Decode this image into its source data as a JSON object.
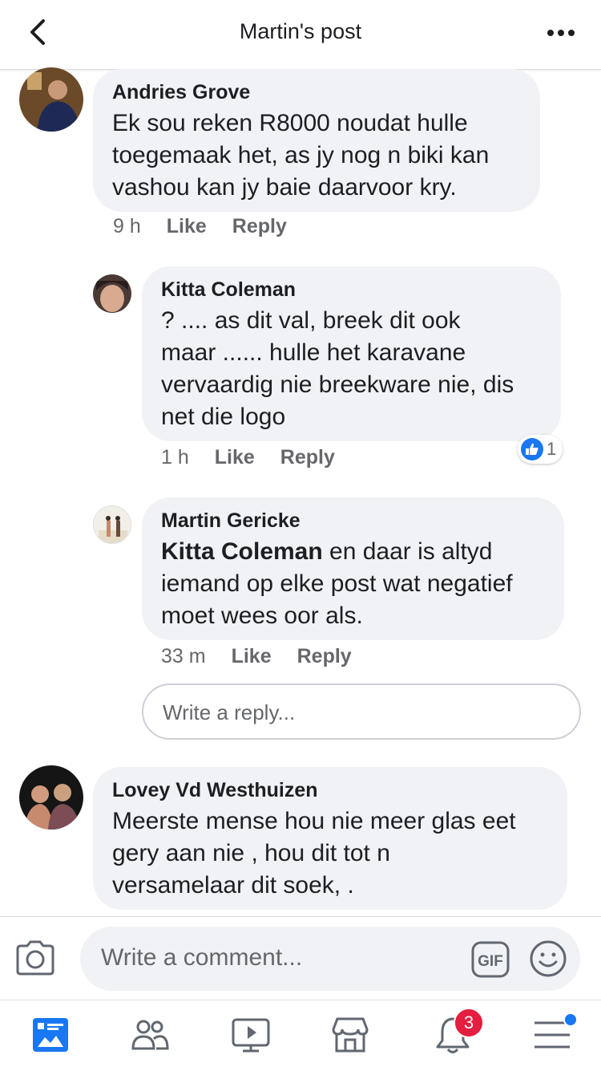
{
  "header": {
    "title": "Martin's post"
  },
  "comments": [
    {
      "author": "Andries Grove",
      "text_lines": [
        "Ek sou reken R8000 noudat hulle",
        "toegemaak het, as jy nog n biki kan",
        "vashou kan jy baie daarvoor kry."
      ],
      "time": "9 h",
      "like": "Like",
      "reply": "Reply"
    },
    {
      "author": "Kitta Coleman",
      "text_lines": [
        "? .... as dit val, breek dit ook",
        "maar ...... hulle het karavane",
        "vervaardig nie breekware nie, dis",
        "net die logo"
      ],
      "time": "1 h",
      "like": "Like",
      "reply": "Reply",
      "reaction_count": "1"
    },
    {
      "author": "Martin Gericke",
      "mention": "Kitta Coleman",
      "text_first_rest": " en daar is altyd",
      "text_lines": [
        "iemand op elke post wat negatief",
        "moet wees oor als."
      ],
      "time": "33 m",
      "like": "Like",
      "reply": "Reply"
    },
    {
      "author": "Lovey Vd Westhuizen",
      "text_lines": [
        "Meerste mense hou nie meer glas eet",
        "gery aan nie , hou dit tot n",
        "versamelaar dit soek, ."
      ]
    }
  ],
  "reply_box": {
    "placeholder": "Write a reply..."
  },
  "composer": {
    "placeholder": "Write a comment...",
    "gif_label": "GIF"
  },
  "tabbar": {
    "notifications_badge": "3"
  },
  "colors": {
    "accent": "#1877f2",
    "bubble": "#f0f2f5",
    "badge": "#e41e3f"
  }
}
